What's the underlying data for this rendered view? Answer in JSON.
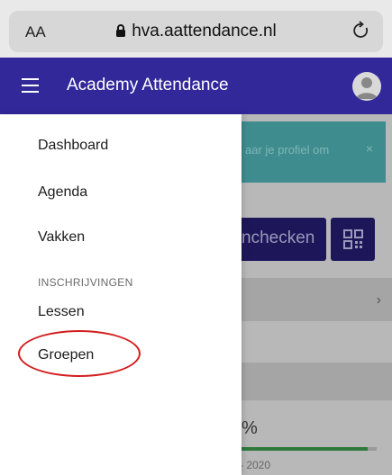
{
  "browser": {
    "text_size_label": "AA",
    "url": "hva.aattendance.nl",
    "icons": {
      "lock": "lock-icon",
      "reload": "reload-icon"
    }
  },
  "header": {
    "title": "Academy Attendance",
    "menu_icon": "hamburger-menu-icon",
    "avatar_icon": "user-avatar-icon",
    "color": "#32289a"
  },
  "drawer": {
    "items": [
      {
        "label": "Dashboard"
      },
      {
        "label": "Agenda"
      },
      {
        "label": "Vakken"
      }
    ],
    "section_label": "INSCHRIJVINGEN",
    "section_items": [
      {
        "label": "Lessen"
      },
      {
        "label": "Groepen"
      }
    ],
    "highlight_color": "#d31e1e"
  },
  "background": {
    "banner_text": "aar je profiel om",
    "banner_close": "×",
    "checkin_label": "nchecken",
    "qr_icon": "qr-code-icon",
    "chevron": "›",
    "percent": "%",
    "progress_fraction": 0.94,
    "year_label": "- 2020"
  }
}
